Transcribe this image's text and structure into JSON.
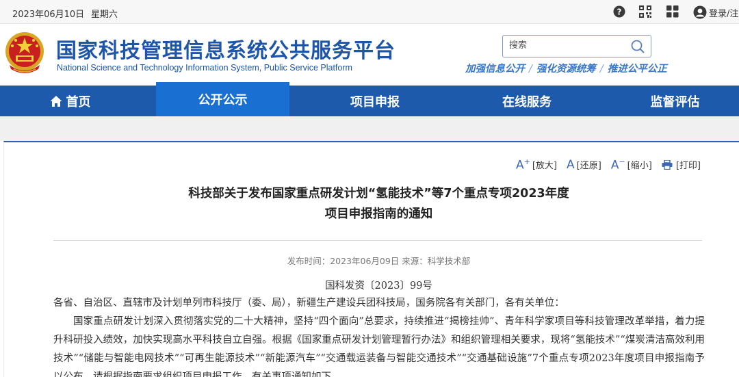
{
  "topbar": {
    "date": "2023年06月10日",
    "weekday": "星期六",
    "icons": [
      "help-icon",
      "qrcode-icon",
      "apps-grid-icon"
    ],
    "login_label": "登录/注"
  },
  "header": {
    "title": "国家科技管理信息系统公共服务平台",
    "subtitle": "National Science and Technology Information System, Public Service Platform",
    "search_placeholder": "搜索",
    "slogan_parts": [
      "加强信息公开",
      "强化资源统筹",
      "推进公平公正"
    ]
  },
  "nav": {
    "items": [
      {
        "label": "首页"
      },
      {
        "label": "公开公示"
      },
      {
        "label": "项目申报"
      },
      {
        "label": "在线服务"
      },
      {
        "label": "监督评估"
      }
    ],
    "active_index": 1
  },
  "tools": {
    "enlarge": "[放大]",
    "restore": "[还原]",
    "shrink": "[缩小]",
    "print": "[打印]"
  },
  "article": {
    "title_line1": "科技部关于发布国家重点研发计划“氢能技术”等7个重点专项2023年度",
    "title_line2": "项目申报指南的通知",
    "meta": "发布时间：2023年06月09日 来源：科学技术部",
    "doc_no": "国科发资〔2023〕99号",
    "salutation": "各省、自治区、直辖市及计划单列市科技厅（委、局），新疆生产建设兵团科技局，国务院各有关部门，各有关单位：",
    "paragraph1": "国家重点研发计划深入贯彻落实党的二十大精神，坚持“四个面向”总要求，持续推进“揭榜挂帅”、青年科学家项目等科技管理改革举措，着力提升科研投入绩效，加快实现高水平科技自立自强。根据《国家重点研发计划管理暂行办法》和组织管理相关要求，现将“氢能技术”“煤炭清洁高效利用技术”“储能与智能电网技术”“可再生能源技术”“新能源汽车”“交通载运装备与智能交通技术”“交通基础设施”7个重点专项2023年度项目申报指南予以公布，请根据指南要求组织项目申报工作。有关事项通知如下。"
  },
  "colors": {
    "brand_blue": "#1e5aab",
    "nav_active": "#1a6fd3",
    "title_blue": "#1d55a8"
  }
}
